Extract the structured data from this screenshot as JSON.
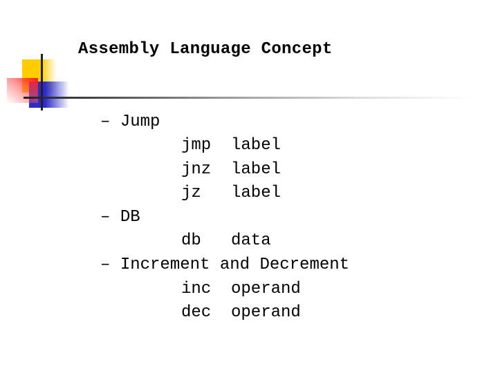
{
  "slide": {
    "title": "Assembly Language Concept",
    "sections": [
      {
        "bullet": "–",
        "heading": "Jump",
        "items": [
          {
            "instr": "jmp",
            "operand": "label"
          },
          {
            "instr": "jnz",
            "operand": "label"
          },
          {
            "instr": "jz",
            "operand": "label"
          }
        ]
      },
      {
        "bullet": "–",
        "heading": "DB",
        "items": [
          {
            "instr": "db",
            "operand": "data"
          }
        ]
      },
      {
        "bullet": "–",
        "heading": "Increment and Decrement",
        "items": [
          {
            "instr": "inc",
            "operand": "operand"
          },
          {
            "instr": "dec",
            "operand": "operand"
          }
        ]
      }
    ]
  }
}
